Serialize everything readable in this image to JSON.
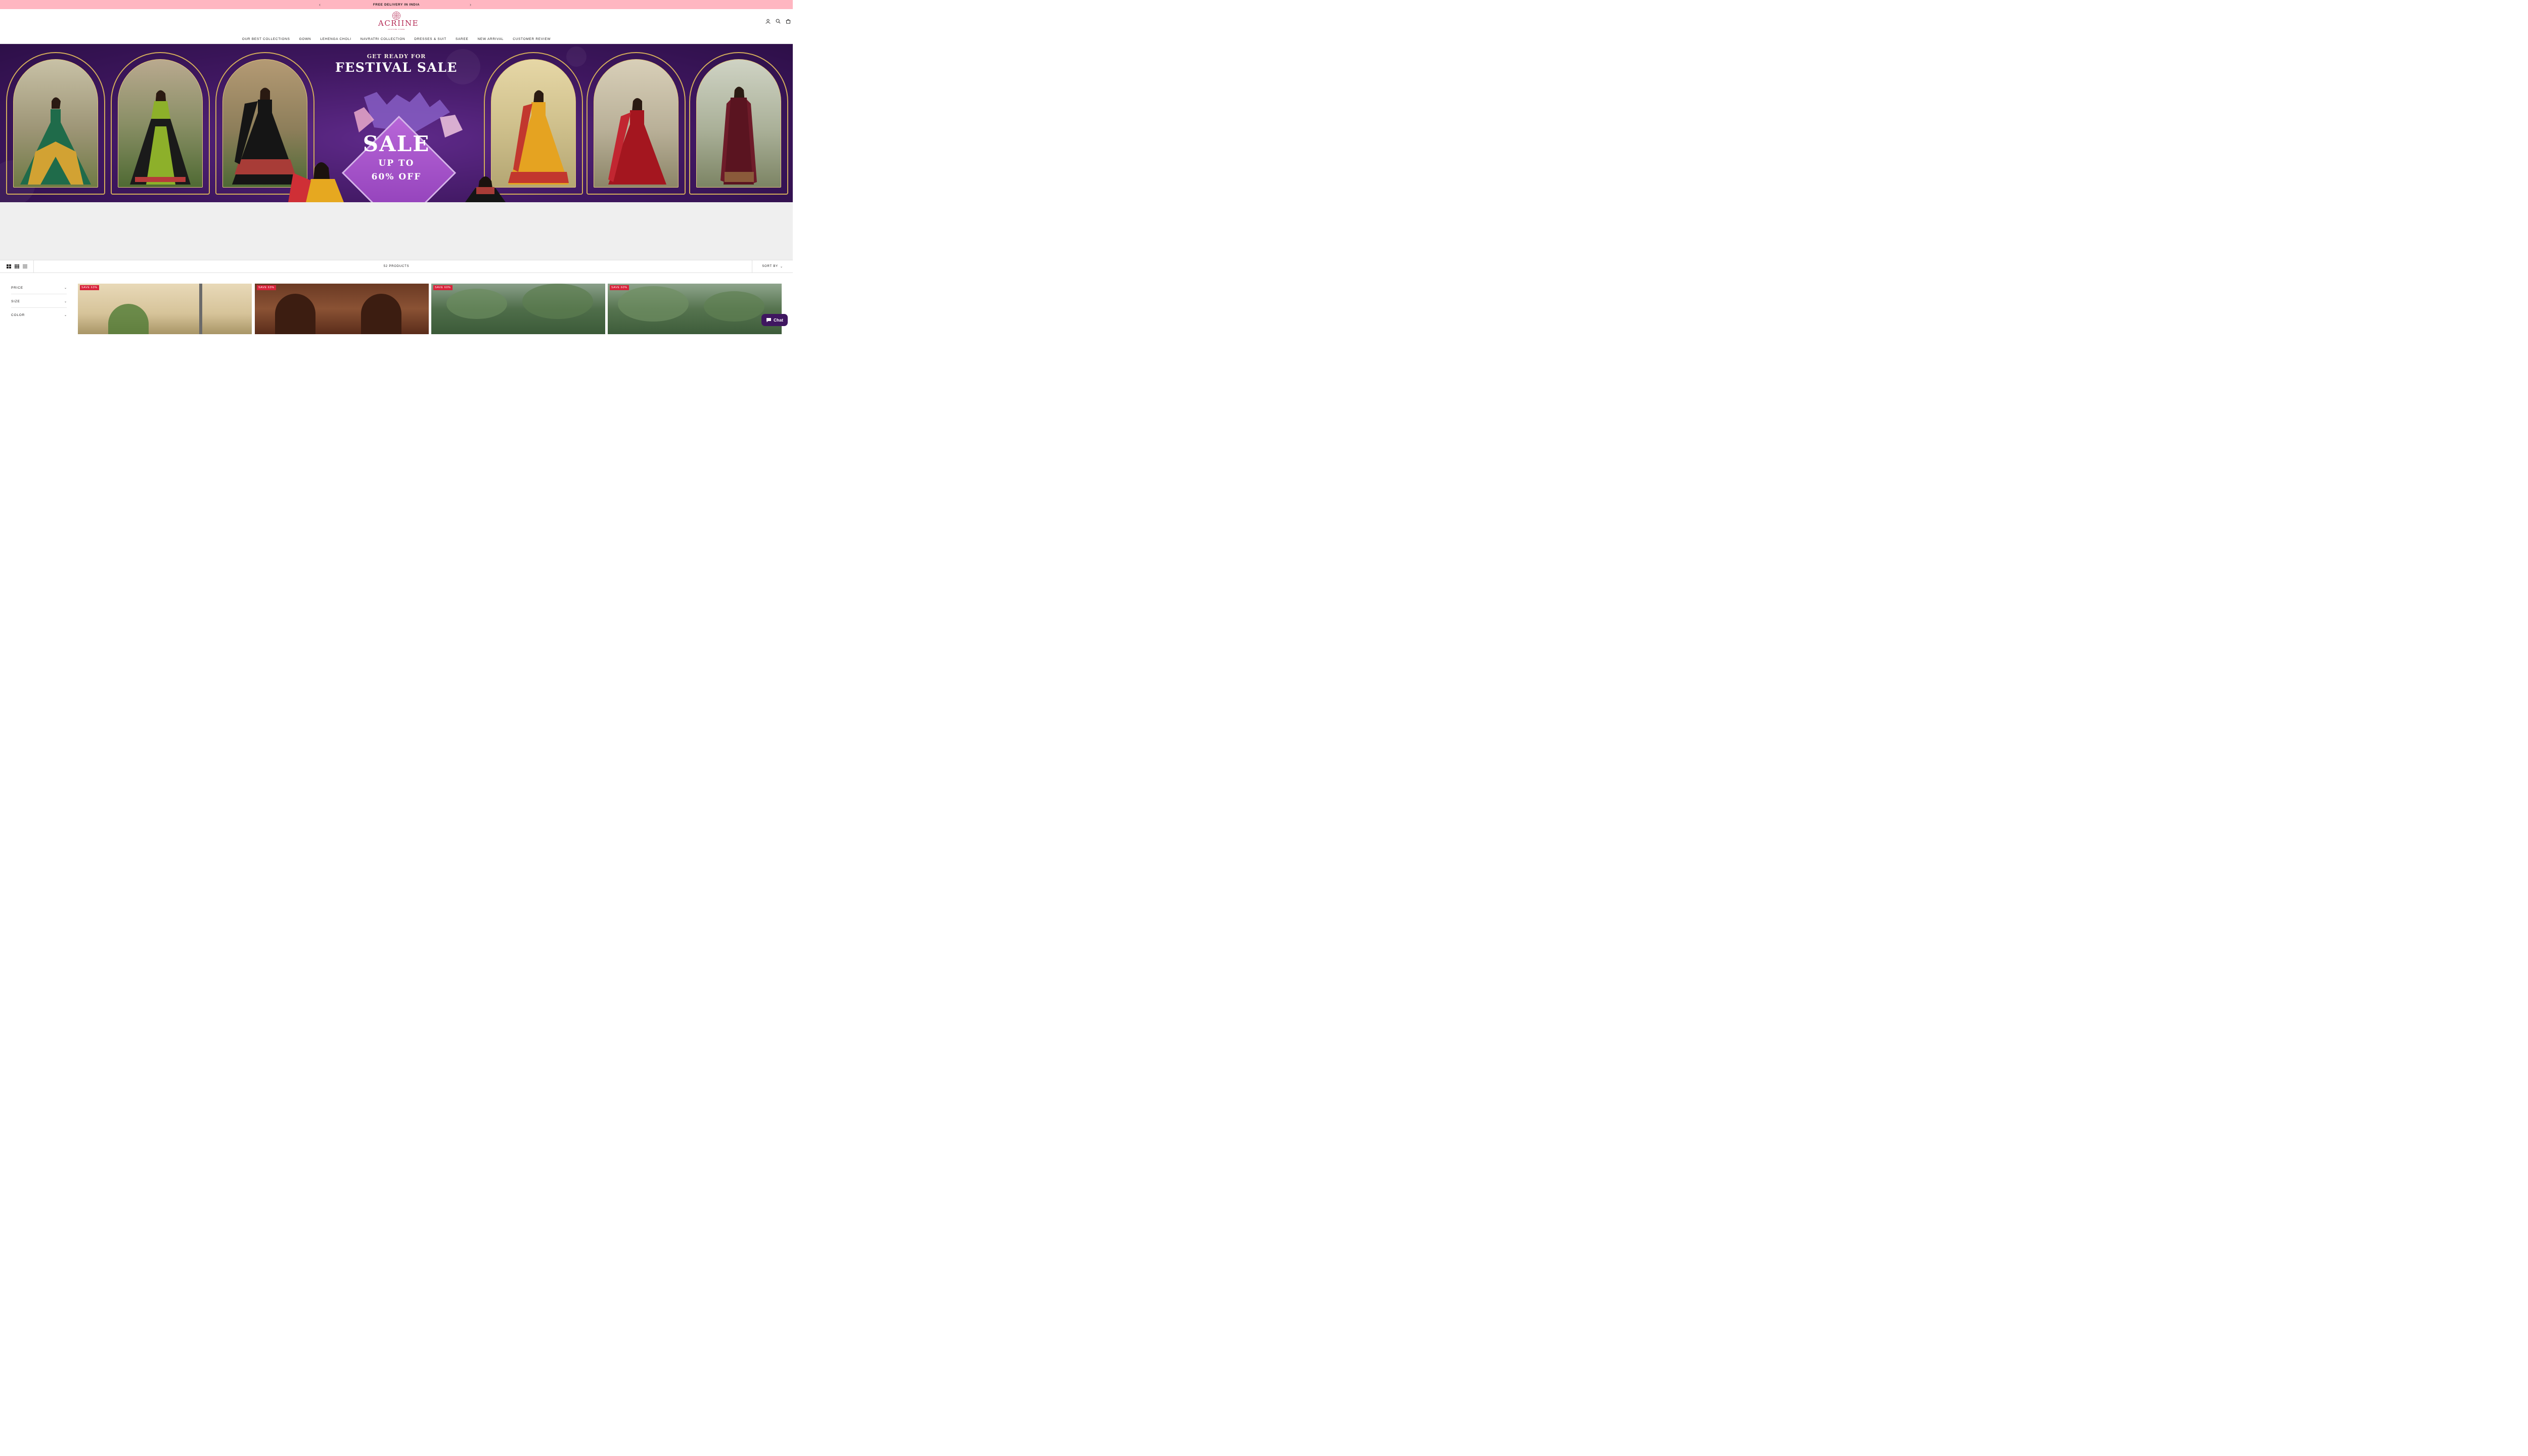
{
  "announcement": {
    "text": "FREE DELIVERY IN INDIA",
    "prev_icon": "chevron-left-icon",
    "next_icon": "chevron-right-icon"
  },
  "header": {
    "logo_text": "ACRIINE",
    "logo_tagline": "COUTURE STORE",
    "icons": [
      "account-icon",
      "search-icon",
      "cart-icon"
    ]
  },
  "nav": {
    "items": [
      "OUR BEST COLLECTIONS",
      "GOWN",
      "LEHENGA CHOLI",
      "NAVRATRI COLLECTION",
      "DRESSES & SUIT",
      "SAREE",
      "NEW ARRIVAL",
      "CUSTOMER REVIEW"
    ]
  },
  "banner": {
    "kicker": "GET READY FOR",
    "title": "FESTIVAL SALE",
    "sale": "SALE",
    "line1": "UP TO",
    "line2": "60% OFF"
  },
  "toolbar": {
    "layout_icons": [
      "grid-2-icon",
      "grid-4-icon",
      "list-icon"
    ],
    "count": "52 PRODUCTS",
    "sort_label": "SORT BY"
  },
  "filters": [
    {
      "label": "PRICE"
    },
    {
      "label": "SIZE"
    },
    {
      "label": "COLOR"
    }
  ],
  "products": [
    {
      "badge": "SAVE 63%"
    },
    {
      "badge": "SAVE 63%"
    },
    {
      "badge": "SAVE 60%"
    },
    {
      "badge": "SAVE 60%"
    }
  ],
  "chat": {
    "label": "Chat"
  },
  "colors": {
    "announcement_bg": "#ffb6c1",
    "brand": "#b42a55",
    "banner_bg": "#3f1760",
    "badge": "#d8233a",
    "gold": "#d3ad5b"
  }
}
